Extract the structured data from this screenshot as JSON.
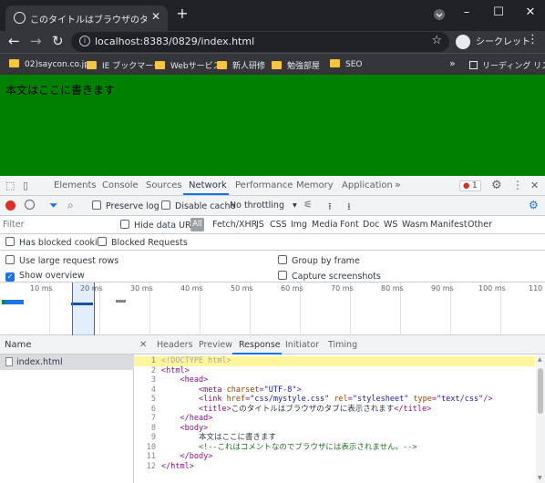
{
  "browser": {
    "tab_title": "このタイトルはブラウザのタブに表示されます",
    "tab_close": "✕",
    "new_tab": "+",
    "url": "localhost:8383/0829/index.html",
    "incognito_label": "シークレット",
    "bookmarks": [
      "02)saycon.co.jp",
      "IE ブックマーク",
      "Webサービス",
      "新人研修",
      "勉強部屋",
      "SEO"
    ],
    "bookmarks_more": "»",
    "reading_list": "リーディング リスト"
  },
  "page": {
    "body_text": "本文はここに書きます",
    "background": "#008000"
  },
  "devtools": {
    "tabs": [
      "Elements",
      "Console",
      "Sources",
      "Network",
      "Performance",
      "Memory",
      "Application"
    ],
    "more_tabs": "»",
    "error_count": "1",
    "network_toolbar": {
      "preserve_log": "Preserve log",
      "disable_cache": "Disable cache",
      "throttling": "No throttling"
    },
    "filter": {
      "placeholder": "Filter",
      "hide_data_urls": "Hide data URLs",
      "types": [
        "All",
        "Fetch/XHR",
        "JS",
        "CSS",
        "Img",
        "Media",
        "Font",
        "Doc",
        "WS",
        "Wasm",
        "Manifest",
        "Other"
      ]
    },
    "options": {
      "has_blocked_cookies": "Has blocked cookies",
      "blocked_requests": "Blocked Requests",
      "use_large_rows": "Use large request rows",
      "group_by_frame": "Group by frame",
      "show_overview": "Show overview",
      "capture_screenshots": "Capture screenshots"
    },
    "overview_ticks": [
      "10 ms",
      "20 ms",
      "30 ms",
      "40 ms",
      "50 ms",
      "60 ms",
      "70 ms",
      "80 ms",
      "90 ms",
      "100 ms",
      "110 r"
    ],
    "requests": {
      "column_name": "Name",
      "items": [
        "index.html"
      ]
    },
    "detail_tabs": [
      "Headers",
      "Preview",
      "Response",
      "Initiator",
      "Timing"
    ],
    "detail_close": "✕",
    "response_lines": [
      {
        "num": "1",
        "tokens": [
          {
            "cls": "d",
            "text": "<!DOCTYPE html>"
          }
        ]
      },
      {
        "num": "2",
        "tokens": [
          {
            "cls": "t",
            "text": "<html>"
          }
        ]
      },
      {
        "num": "3",
        "tokens": [
          {
            "cls": "tx",
            "text": "    "
          },
          {
            "cls": "t",
            "text": "<head>"
          }
        ]
      },
      {
        "num": "4",
        "tokens": [
          {
            "cls": "tx",
            "text": "        "
          },
          {
            "cls": "t",
            "text": "<meta "
          },
          {
            "cls": "a",
            "text": "charset"
          },
          {
            "cls": "t",
            "text": "="
          },
          {
            "cls": "v",
            "text": "\"UTF-8\""
          },
          {
            "cls": "t",
            "text": ">"
          }
        ]
      },
      {
        "num": "5",
        "tokens": [
          {
            "cls": "tx",
            "text": "        "
          },
          {
            "cls": "t",
            "text": "<link "
          },
          {
            "cls": "a",
            "text": "href"
          },
          {
            "cls": "t",
            "text": "="
          },
          {
            "cls": "v",
            "text": "\"css/mystyle.css\""
          },
          {
            "cls": "t",
            "text": " "
          },
          {
            "cls": "a",
            "text": "rel"
          },
          {
            "cls": "t",
            "text": "="
          },
          {
            "cls": "v",
            "text": "\"stylesheet\""
          },
          {
            "cls": "t",
            "text": " "
          },
          {
            "cls": "a",
            "text": "type"
          },
          {
            "cls": "t",
            "text": "="
          },
          {
            "cls": "v",
            "text": "\"text/css\""
          },
          {
            "cls": "t",
            "text": "/>"
          }
        ]
      },
      {
        "num": "6",
        "tokens": [
          {
            "cls": "tx",
            "text": "        "
          },
          {
            "cls": "t",
            "text": "<title>"
          },
          {
            "cls": "tx",
            "text": "このタイトルはブラウザのタブに表示されます"
          },
          {
            "cls": "t",
            "text": "</title>"
          }
        ]
      },
      {
        "num": "7",
        "tokens": [
          {
            "cls": "tx",
            "text": "    "
          },
          {
            "cls": "t",
            "text": "</head>"
          }
        ]
      },
      {
        "num": "8",
        "tokens": [
          {
            "cls": "tx",
            "text": "    "
          },
          {
            "cls": "t",
            "text": "<body>"
          }
        ]
      },
      {
        "num": "9",
        "tokens": [
          {
            "cls": "tx",
            "text": "        本文はここに書きます"
          }
        ]
      },
      {
        "num": "10",
        "tokens": [
          {
            "cls": "tx",
            "text": "        "
          },
          {
            "cls": "c",
            "text": "<!--これはコメントなのでブラウザには表示されません。-->"
          }
        ]
      },
      {
        "num": "11",
        "tokens": [
          {
            "cls": "tx",
            "text": "    "
          },
          {
            "cls": "t",
            "text": "</body>"
          }
        ]
      },
      {
        "num": "12",
        "tokens": [
          {
            "cls": "t",
            "text": "</html>"
          }
        ]
      }
    ]
  }
}
